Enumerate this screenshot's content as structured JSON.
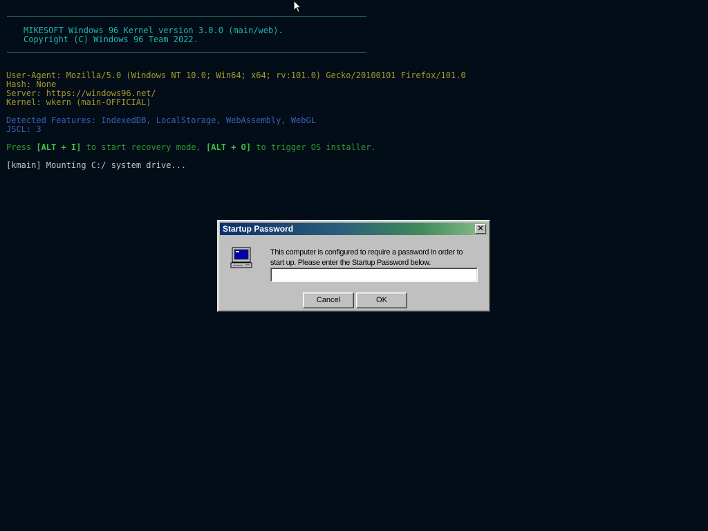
{
  "console": {
    "banner_line1": "MIKESOFT Windows 96 Kernel version 3.0.0 (main/web).",
    "banner_line2": "Copyright (C) Windows 96 Team 2022.",
    "info": [
      "User-Agent: Mozilla/5.0 (Windows NT 10.0; Win64; x64; rv:101.0) Gecko/20100101 Firefox/101.0",
      "Hash: None",
      "Server: https://windows96.net/",
      "Kernel: wkern (main-OFFICIAL)"
    ],
    "features": "Detected Features: IndexedDB, LocalStorage, WebAssembly, WebGL",
    "jscl": "JSCL: 3",
    "recovery": {
      "prefix": "Press ",
      "key1": "[ALT + I]",
      "middle": " to start recovery mode, ",
      "key2": "[ALT + O]",
      "suffix": " to trigger OS installer."
    },
    "mount_line": "[kmain] Mounting C:/ system drive..."
  },
  "dialog": {
    "title": "Startup Password",
    "close_glyph": "✕",
    "message": "This computer is configured to require a password in order to start up. Please enter the Startup Password below.",
    "password_value": "",
    "cancel_label": "Cancel",
    "ok_label": "OK"
  },
  "colors": {
    "background": "#020d17",
    "banner": "#1fb5b0",
    "info": "#a79a2a",
    "features": "#3a5fb8",
    "recovery": "#2e9a2e"
  },
  "icons": [
    "mouse-cursor-icon",
    "computer-icon",
    "close-icon"
  ]
}
